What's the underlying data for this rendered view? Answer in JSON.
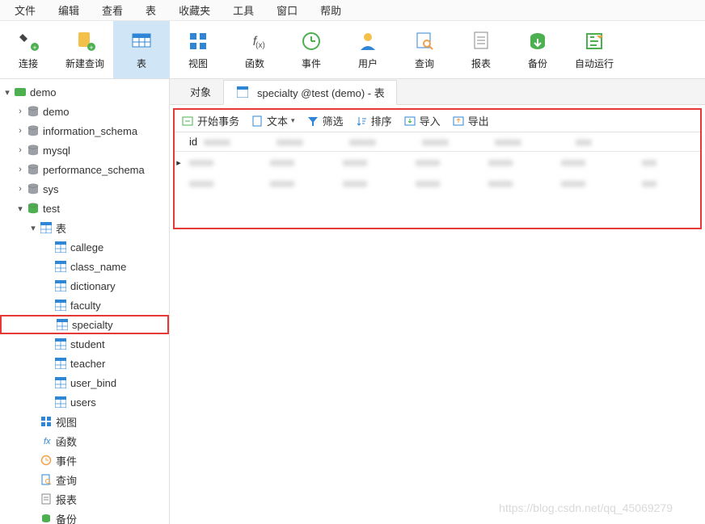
{
  "menu": [
    "文件",
    "编辑",
    "查看",
    "表",
    "收藏夹",
    "工具",
    "窗口",
    "帮助"
  ],
  "toolbar": [
    {
      "name": "connect-btn",
      "label": "连接",
      "icon": "plug"
    },
    {
      "name": "newquery-btn",
      "label": "新建查询",
      "icon": "new-sheet"
    },
    {
      "name": "table-btn",
      "label": "表",
      "icon": "table",
      "active": true
    },
    {
      "name": "view-btn",
      "label": "视图",
      "icon": "grid"
    },
    {
      "name": "function-btn",
      "label": "函数",
      "icon": "fx"
    },
    {
      "name": "event-btn",
      "label": "事件",
      "icon": "clock"
    },
    {
      "name": "user-btn",
      "label": "用户",
      "icon": "user"
    },
    {
      "name": "query-btn",
      "label": "查询",
      "icon": "query"
    },
    {
      "name": "report-btn",
      "label": "报表",
      "icon": "report"
    },
    {
      "name": "backup-btn",
      "label": "备份",
      "icon": "backup"
    },
    {
      "name": "autorun-btn",
      "label": "自动运行",
      "icon": "autorun"
    }
  ],
  "tree": {
    "connection": {
      "name": "demo",
      "expanded": true
    },
    "databases": [
      {
        "name": "demo",
        "expanded": false
      },
      {
        "name": "information_schema",
        "expanded": false
      },
      {
        "name": "mysql",
        "expanded": false
      },
      {
        "name": "performance_schema",
        "expanded": false
      },
      {
        "name": "sys",
        "expanded": false
      },
      {
        "name": "test",
        "expanded": true,
        "nodes": [
          {
            "name": "表",
            "type": "folder-table",
            "expanded": true,
            "tables": [
              "callege",
              "class_name",
              "dictionary",
              "faculty",
              "specialty",
              "student",
              "teacher",
              "user_bind",
              "users"
            ],
            "selected": "specialty"
          },
          {
            "name": "视图",
            "type": "view"
          },
          {
            "name": "函数",
            "type": "fx"
          },
          {
            "name": "事件",
            "type": "event"
          },
          {
            "name": "查询",
            "type": "query"
          },
          {
            "name": "报表",
            "type": "report"
          },
          {
            "name": "备份",
            "type": "backup"
          }
        ]
      }
    ]
  },
  "tabs": [
    {
      "name": "objects-tab",
      "label": "对象",
      "active": false
    },
    {
      "name": "specialty-tab",
      "label": "specialty @test (demo) - 表",
      "active": true,
      "icon": "table"
    }
  ],
  "content_toolbar": [
    {
      "name": "begin-txn-btn",
      "label": "开始事务",
      "icon": "txn"
    },
    {
      "name": "text-btn",
      "label": "文本",
      "icon": "text",
      "dropdown": true
    },
    {
      "name": "filter-btn",
      "label": "筛选",
      "icon": "filter"
    },
    {
      "name": "sort-btn",
      "label": "排序",
      "icon": "sort"
    },
    {
      "name": "import-btn",
      "label": "导入",
      "icon": "import"
    },
    {
      "name": "export-btn",
      "label": "导出",
      "icon": "export"
    }
  ],
  "table": {
    "columns": [
      "id",
      "",
      "",
      "",
      "",
      "",
      ""
    ],
    "rows": [
      {
        "selected": true,
        "cells": [
          "",
          "",
          "",
          "",
          "",
          "",
          ""
        ]
      },
      {
        "selected": false,
        "cells": [
          "",
          "",
          "",
          "",
          "",
          "",
          ""
        ]
      }
    ]
  },
  "watermark": "https://blog.csdn.net/qq_45069279"
}
